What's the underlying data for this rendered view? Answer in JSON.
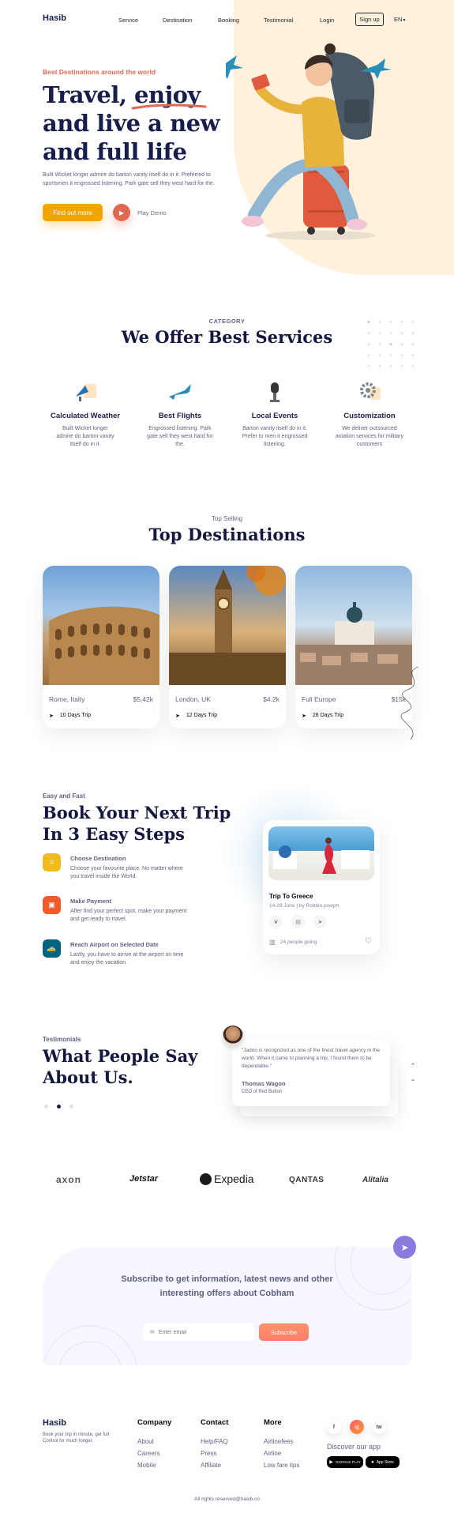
{
  "nav": {
    "logo": "Hasib",
    "links": [
      "Service",
      "Destination",
      "Booking",
      "Testimonial",
      "Login"
    ],
    "signup": "Sign up",
    "language": "EN"
  },
  "hero": {
    "eyebrow": "Best Destinations around the world",
    "title_line1": "Travel, enjoy",
    "title_line2": "and live a new",
    "title_line3": "and full life",
    "description": "Built Wicket longer admire do barton vanity itself do in it. Preferred to sportsmen it engrossed listening. Park gate sell they west hard for the.",
    "cta": "Find out more",
    "play": "Play Demo"
  },
  "services": {
    "eyebrow": "CATEGORY",
    "title": "We Offer Best Services",
    "items": [
      {
        "title": "Calculated Weather",
        "text": "Built Wicket longer admire do barton vanity itself do in it."
      },
      {
        "title": "Best Flights",
        "text": "Engrossed listening. Park gate sell they west hard for the."
      },
      {
        "title": "Local Events",
        "text": "Barton vanity itself do in it. Prefer to men it engrossed listening."
      },
      {
        "title": "Customization",
        "text": "We deliver outsourced aviation services for military customers"
      }
    ]
  },
  "destinations": {
    "eyebrow": "Top Selling",
    "title": "Top Destinations",
    "items": [
      {
        "name": "Rome, Italty",
        "price": "$5,42k",
        "trip": "10 Days Trip"
      },
      {
        "name": "London, UK",
        "price": "$4.2k",
        "trip": "12 Days Trip"
      },
      {
        "name": "Full Europe",
        "price": "$15k",
        "trip": "28 Days Trip"
      }
    ]
  },
  "booking": {
    "eyebrow": "Easy and Fast",
    "title_line1": "Book Your Next Trip",
    "title_line2": "In 3 Easy Steps",
    "steps": [
      {
        "title": "Choose Destination",
        "text": "Choose your favourite place. No matter where you travel inside the World."
      },
      {
        "title": "Make Payment",
        "text": "After find your perfect spot, make your payment and get ready to travel."
      },
      {
        "title": "Reach Airport on Selected Date",
        "text": "Lastly, you have to arrive at the airport on time and enjoy the vacation."
      }
    ],
    "trip_card": {
      "title": "Trip To Greece",
      "meta": "14-29 June | by Robbin joseph",
      "going": "24 people going"
    }
  },
  "testimonials": {
    "eyebrow": "Testimonials",
    "title_line1": "What People Say",
    "title_line2": "About Us.",
    "quote": "\"Jadoo is recognized as one of the finest travel agency in the world. When it came to planning a trip, I found them to be dependable.\"",
    "author": "Thomas Wagon",
    "role": "CEO of Red Button"
  },
  "partners": [
    "axon",
    "Jetstar",
    "Expedia",
    "QANTAS",
    "Alitalia"
  ],
  "subscribe": {
    "title_line1": "Subscribe to get information, latest news and other",
    "title_line2": "interesting offers about Cobham",
    "placeholder": "Enter email",
    "button": "Subscribe"
  },
  "footer": {
    "brand": "Hasib",
    "tagline": "Book your trip in minute, get full Control for much longer.",
    "columns": [
      {
        "title": "Company",
        "links": [
          "About",
          "Careers",
          "Mobile"
        ]
      },
      {
        "title": "Contact",
        "links": [
          "Help/FAQ",
          "Press",
          "Affiliate"
        ]
      },
      {
        "title": "More",
        "links": [
          "Airlinefees",
          "Airline",
          "Low fare tips"
        ]
      }
    ],
    "social": [
      "f",
      "ig",
      "tw"
    ],
    "app_title": "Discover our app",
    "google_play": "GOOGLE PLAY",
    "app_store": "App Store",
    "copyright": "All rights reserved@hasib.co"
  },
  "colors": {
    "navy": "#181e4b",
    "accent_orange": "#df6951",
    "yellow": "#f1a501",
    "peach": "#fff1dc",
    "teal": "#006380",
    "purple": "#8a79df"
  }
}
